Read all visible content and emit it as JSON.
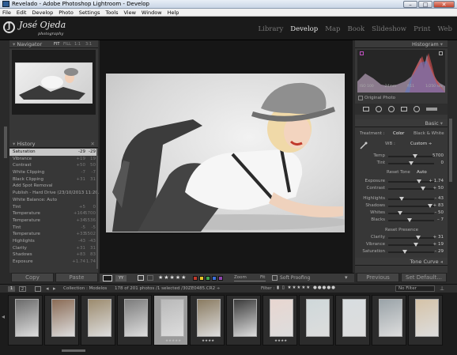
{
  "window": {
    "title": "Revelado - Adobe Photoshop Lightroom - Develop",
    "controls": [
      "–",
      "□",
      "✕"
    ]
  },
  "menu": [
    "File",
    "Edit",
    "Develop",
    "Photo",
    "Settings",
    "Tools",
    "View",
    "Window",
    "Help"
  ],
  "identity": {
    "name": "José Ojeda",
    "sub": "photography",
    "mark": "J"
  },
  "modules": [
    "Library",
    "Develop",
    "Map",
    "Book",
    "Slideshow",
    "Print",
    "Web"
  ],
  "navigator": {
    "title": "Navigator",
    "zoom": [
      "FIT",
      "FILL",
      "1:1",
      "3:1"
    ]
  },
  "history": {
    "title": "History",
    "items": [
      {
        "label": "Saturation",
        "a": "-29",
        "b": "-29"
      },
      {
        "label": "Vibrance",
        "a": "+19",
        "b": "19"
      },
      {
        "label": "Contrast",
        "a": "+50",
        "b": "50"
      },
      {
        "label": "White Clipping",
        "a": "-7",
        "b": "-7"
      },
      {
        "label": "Black Clipping",
        "a": "+31",
        "b": "31"
      },
      {
        "label": "Add Spot Removal",
        "a": "",
        "b": ""
      },
      {
        "label": "Publish - Hard Drive (23/10/2013 11:20...",
        "a": "",
        "b": ""
      },
      {
        "label": "White Balance: Auto",
        "a": "",
        "b": ""
      },
      {
        "label": "Tint",
        "a": "+5",
        "b": "0"
      },
      {
        "label": "Temperature",
        "a": "+164",
        "b": "5700"
      },
      {
        "label": "Temperature",
        "a": "+34",
        "b": "5536"
      },
      {
        "label": "Tint",
        "a": "-5",
        "b": "-5"
      },
      {
        "label": "Temperature",
        "a": "+33",
        "b": "5502"
      },
      {
        "label": "Highlights",
        "a": "-43",
        "b": "-43"
      },
      {
        "label": "Clarity",
        "a": "+31",
        "b": "31"
      },
      {
        "label": "Shadows",
        "a": "+83",
        "b": "83"
      },
      {
        "label": "Exposure",
        "a": "+1.74",
        "b": "1.74"
      }
    ],
    "selected": 0
  },
  "left_buttons": {
    "copy": "Copy",
    "paste": "Paste"
  },
  "histogram": {
    "title": "Histogram",
    "readout": [
      "ISO 100",
      "24mm",
      "f/11",
      "1/250 sec"
    ],
    "original_photo": "Original Photo"
  },
  "basic": {
    "title": "Basic",
    "treatment_label": "Treatment :",
    "treatment_options": [
      "Color",
      "Black & White"
    ],
    "wb_label": "WB :",
    "wb_value": "Custom ÷",
    "tone_label": "Tone",
    "tone_auto": "Auto",
    "reset_tone": "Reset Tone",
    "presence_label": "Reset Presence",
    "sliders_wb": [
      {
        "name": "Temp",
        "value": "5700",
        "pos": 0.58
      },
      {
        "name": "Tint",
        "value": "0",
        "pos": 0.5
      }
    ],
    "sliders_tone": [
      {
        "name": "Exposure",
        "value": "+ 1.74",
        "pos": 0.67
      },
      {
        "name": "Contrast",
        "value": "+ 50",
        "pos": 0.75
      }
    ],
    "sliders_tone2": [
      {
        "name": "Highlights",
        "value": "– 43",
        "pos": 0.29
      },
      {
        "name": "Shadows",
        "value": "+ 83",
        "pos": 0.92
      },
      {
        "name": "Whites",
        "value": "– 50",
        "pos": 0.25
      },
      {
        "name": "Blacks",
        "value": "– 7",
        "pos": 0.47
      }
    ],
    "sliders_presence": [
      {
        "name": "Clarity",
        "value": "+ 31",
        "pos": 0.66
      },
      {
        "name": "Vibrance",
        "value": "+ 19",
        "pos": 0.6
      },
      {
        "name": "Saturation",
        "value": "– 29",
        "pos": 0.36
      }
    ]
  },
  "tone_curve": {
    "title": "Tone Curve"
  },
  "right_buttons": {
    "previous": "Previous",
    "set_default": "Set Default..."
  },
  "toolbar": {
    "rating": "★★★★★",
    "zoom_label": "Zoom",
    "zoom_value": "Fit",
    "soft_proof": "Soft Proofing",
    "color_labels": [
      "#c0392b",
      "#e6c229",
      "#3fa34d",
      "#3a6fd8",
      "#8e44ad"
    ]
  },
  "filmstrip_bar": {
    "pages": [
      "1",
      "2"
    ],
    "collection": "Collection : Modelos",
    "count": "178 of 201 photos /1 selected /30ZE0485.CR2 ÷",
    "filter_label": "Filter :",
    "filter_value": "No Filter"
  },
  "thumbnails": [
    {
      "stars": "",
      "tone": "#6b6b6b"
    },
    {
      "stars": "",
      "tone": "#8a6b55"
    },
    {
      "stars": "",
      "tone": "#9c8b6e"
    },
    {
      "stars": "",
      "tone": "#7c7c7c"
    },
    {
      "stars": "★★★★★",
      "tone": "#b9b9b9"
    },
    {
      "stars": "★★★★",
      "tone": "#8a7b61"
    },
    {
      "stars": "",
      "tone": "#3b3b3b"
    },
    {
      "stars": "★★★★",
      "tone": "#e8d6d0"
    },
    {
      "stars": "",
      "tone": "#cfd8da"
    },
    {
      "stars": "",
      "tone": "#d8dde0"
    },
    {
      "stars": "",
      "tone": "#9aa3a8"
    },
    {
      "stars": "",
      "tone": "#d5c3a8"
    }
  ],
  "thumbnail_selected": 4
}
